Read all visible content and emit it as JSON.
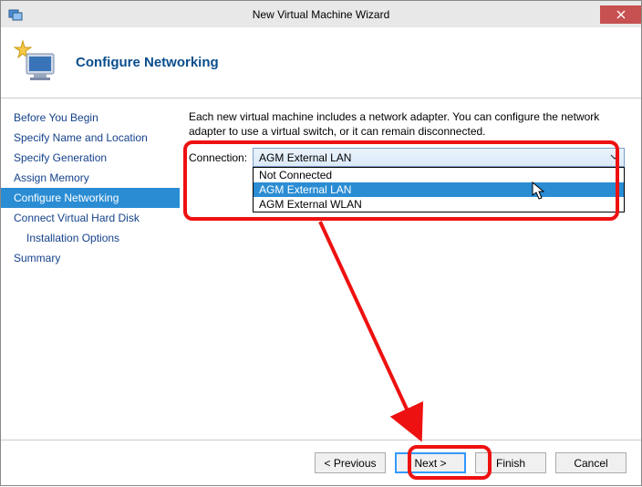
{
  "window": {
    "title": "New Virtual Machine Wizard"
  },
  "header": {
    "title": "Configure Networking"
  },
  "sidebar": {
    "items": [
      {
        "label": "Before You Begin"
      },
      {
        "label": "Specify Name and Location"
      },
      {
        "label": "Specify Generation"
      },
      {
        "label": "Assign Memory"
      },
      {
        "label": "Configure Networking",
        "active": true
      },
      {
        "label": "Connect Virtual Hard Disk"
      },
      {
        "label": "Installation Options",
        "sub": true
      },
      {
        "label": "Summary"
      }
    ]
  },
  "main": {
    "description": "Each new virtual machine includes a network adapter. You can configure the network adapter to use a virtual switch, or it can remain disconnected.",
    "connection_label": "Connection:",
    "connection_selected": "AGM External LAN",
    "connection_options": [
      {
        "label": "Not Connected"
      },
      {
        "label": "AGM External LAN",
        "highlighted": true
      },
      {
        "label": "AGM External WLAN"
      }
    ]
  },
  "footer": {
    "previous": "< Previous",
    "next": "Next >",
    "finish": "Finish",
    "cancel": "Cancel"
  }
}
